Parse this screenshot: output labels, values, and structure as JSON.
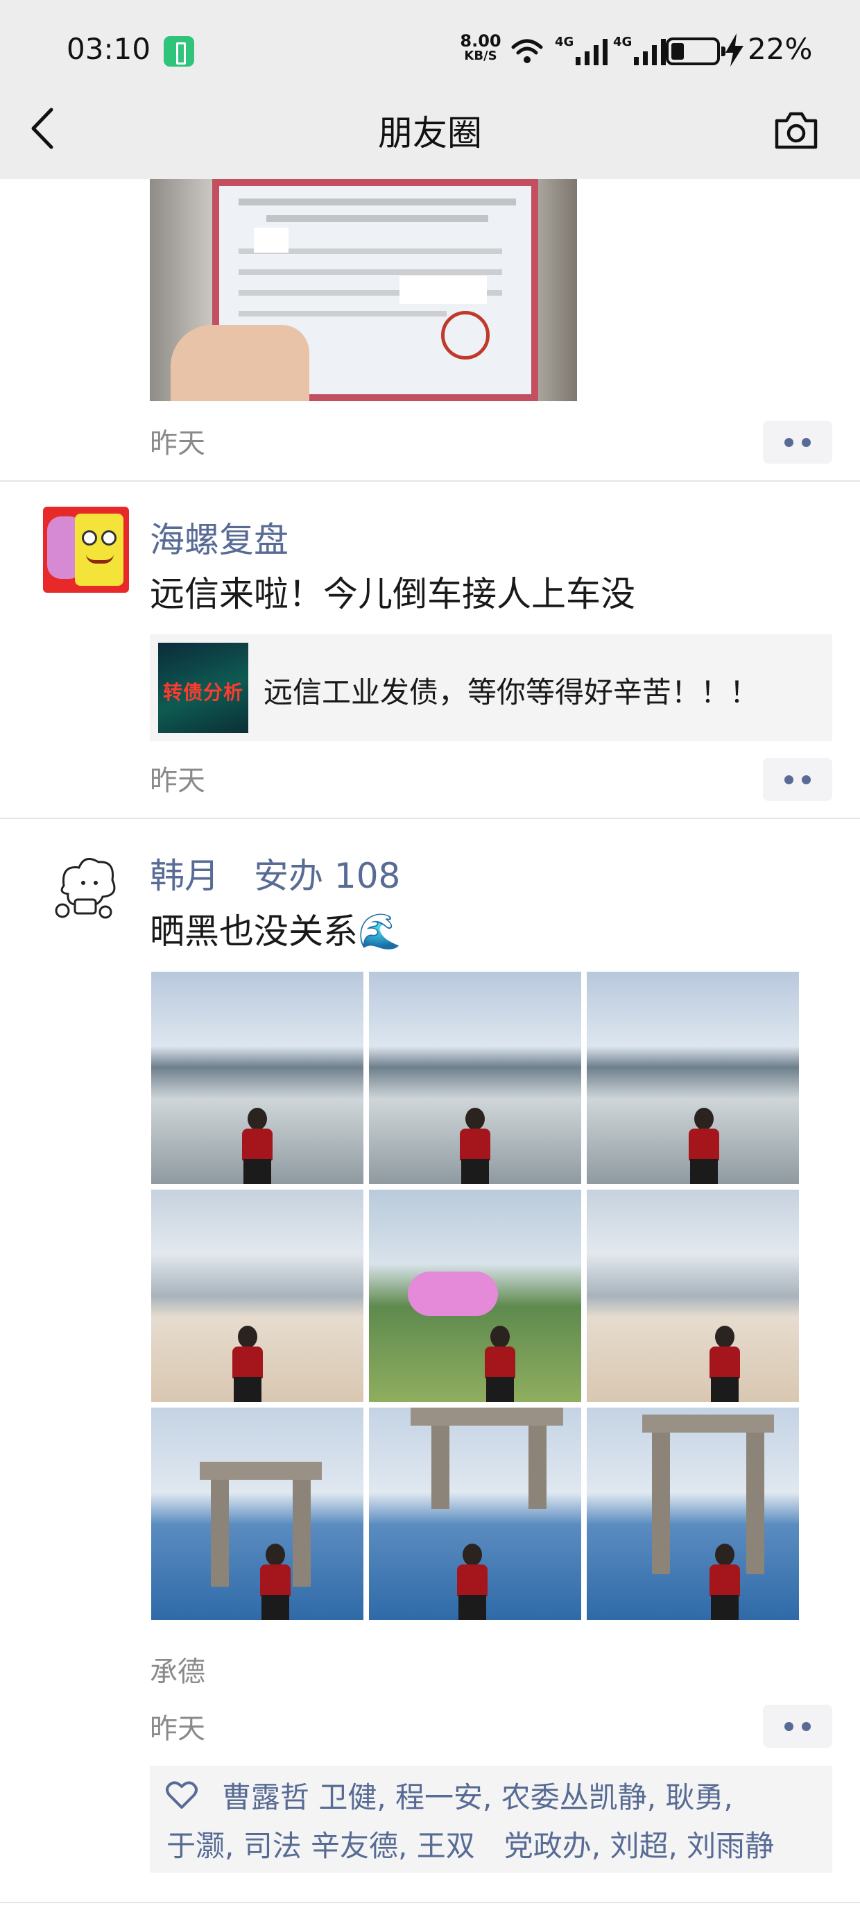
{
  "status_bar": {
    "time": "03:10",
    "net_speed_value": "8.00",
    "net_speed_unit": "KB/S",
    "network_tag_1": "4G",
    "network_tag_2": "4G",
    "battery_percent": "22%"
  },
  "nav": {
    "title": "朋友圈",
    "back_icon": "chevron-left-icon",
    "camera_icon": "camera-icon"
  },
  "posts": [
    {
      "time": "昨天"
    },
    {
      "author": "海螺复盘",
      "text": "远信来啦！今儿倒车接人上车没",
      "link_card": {
        "thumb_text": "转债分析",
        "text": "远信工业发债，等你等得好辛苦！！！"
      },
      "time": "昨天"
    },
    {
      "author": "韩月　安办 108",
      "text": "晒黑也没关系🌊",
      "location": "承德",
      "time": "昨天",
      "likes_line1": "曹露哲  卫健, 程一安, 农委丛凯静, 耿勇,",
      "likes_line2": "于灏, 司法 辛友德, 王双　党政办, 刘超, 刘雨静"
    }
  ],
  "colors": {
    "link_blue": "#576b95",
    "background": "#ffffff",
    "topbar": "#ededed",
    "card_gray": "#f4f4f4"
  }
}
